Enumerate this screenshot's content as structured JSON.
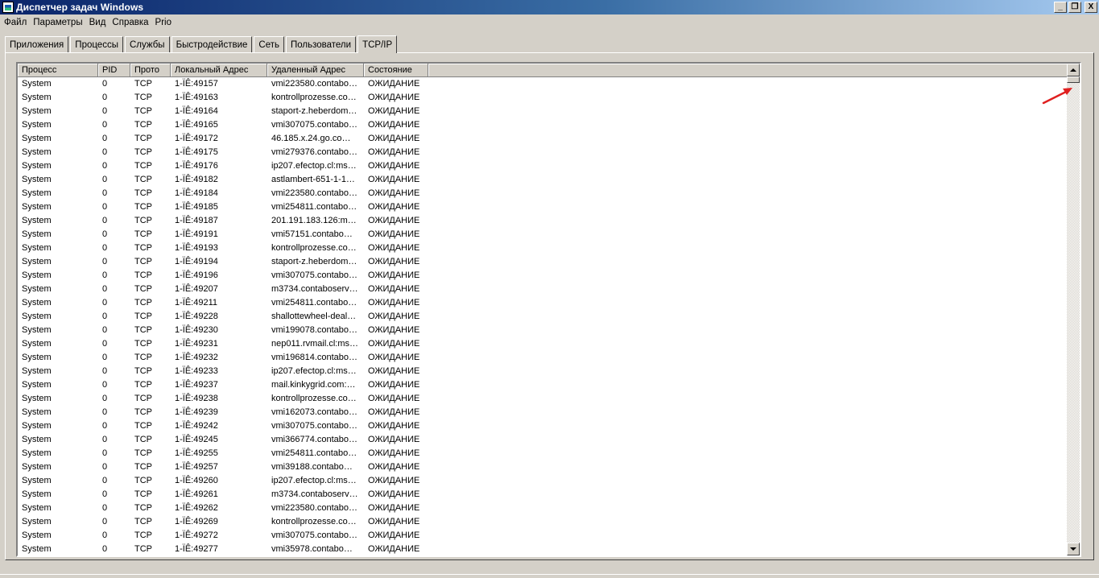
{
  "window": {
    "title": "Диспетчер задач Windows",
    "controls": {
      "minimize": "_",
      "restore": "❐",
      "close": "X"
    }
  },
  "menu": [
    "Файл",
    "Параметры",
    "Вид",
    "Справка",
    "Prio"
  ],
  "tabs": [
    "Приложения",
    "Процессы",
    "Службы",
    "Быстродействие",
    "Сеть",
    "Пользователи",
    "TCP/IP"
  ],
  "active_tab": "TCP/IP",
  "table": {
    "columns": [
      "Процесс",
      "PID",
      "Прото",
      "Локальный Адрес",
      "Удаленный Адрес",
      "Состояние"
    ],
    "rows": [
      [
        "System",
        "0",
        "TCP",
        "1-ÏÊ:49157",
        "vmi223580.contabo…",
        "ОЖИДАНИЕ"
      ],
      [
        "System",
        "0",
        "TCP",
        "1-ÏÊ:49163",
        "kontrollprozesse.co…",
        "ОЖИДАНИЕ"
      ],
      [
        "System",
        "0",
        "TCP",
        "1-ÏÊ:49164",
        "staport-z.heberdom…",
        "ОЖИДАНИЕ"
      ],
      [
        "System",
        "0",
        "TCP",
        "1-ÏÊ:49165",
        "vmi307075.contabo…",
        "ОЖИДАНИЕ"
      ],
      [
        "System",
        "0",
        "TCP",
        "1-ÏÊ:49172",
        "46.185.x.24.go.co…",
        "ОЖИДАНИЕ"
      ],
      [
        "System",
        "0",
        "TCP",
        "1-ÏÊ:49175",
        "vmi279376.contabo…",
        "ОЖИДАНИЕ"
      ],
      [
        "System",
        "0",
        "TCP",
        "1-ÏÊ:49176",
        "ip207.efectop.cl:ms…",
        "ОЖИДАНИЕ"
      ],
      [
        "System",
        "0",
        "TCP",
        "1-ÏÊ:49182",
        "astlambert-651-1-1…",
        "ОЖИДАНИЕ"
      ],
      [
        "System",
        "0",
        "TCP",
        "1-ÏÊ:49184",
        "vmi223580.contabo…",
        "ОЖИДАНИЕ"
      ],
      [
        "System",
        "0",
        "TCP",
        "1-ÏÊ:49185",
        "vmi254811.contabo…",
        "ОЖИДАНИЕ"
      ],
      [
        "System",
        "0",
        "TCP",
        "1-ÏÊ:49187",
        "201.191.183.126:m…",
        "ОЖИДАНИЕ"
      ],
      [
        "System",
        "0",
        "TCP",
        "1-ÏÊ:49191",
        "vmi57151.contabo…",
        "ОЖИДАНИЕ"
      ],
      [
        "System",
        "0",
        "TCP",
        "1-ÏÊ:49193",
        "kontrollprozesse.co…",
        "ОЖИДАНИЕ"
      ],
      [
        "System",
        "0",
        "TCP",
        "1-ÏÊ:49194",
        "staport-z.heberdom…",
        "ОЖИДАНИЕ"
      ],
      [
        "System",
        "0",
        "TCP",
        "1-ÏÊ:49196",
        "vmi307075.contabo…",
        "ОЖИДАНИЕ"
      ],
      [
        "System",
        "0",
        "TCP",
        "1-ÏÊ:49207",
        "m3734.contaboserv…",
        "ОЖИДАНИЕ"
      ],
      [
        "System",
        "0",
        "TCP",
        "1-ÏÊ:49211",
        "vmi254811.contabo…",
        "ОЖИДАНИЕ"
      ],
      [
        "System",
        "0",
        "TCP",
        "1-ÏÊ:49228",
        "shallottewheel-deal…",
        "ОЖИДАНИЕ"
      ],
      [
        "System",
        "0",
        "TCP",
        "1-ÏÊ:49230",
        "vmi199078.contabo…",
        "ОЖИДАНИЕ"
      ],
      [
        "System",
        "0",
        "TCP",
        "1-ÏÊ:49231",
        "nep011.rvmail.cl:ms…",
        "ОЖИДАНИЕ"
      ],
      [
        "System",
        "0",
        "TCP",
        "1-ÏÊ:49232",
        "vmi196814.contabo…",
        "ОЖИДАНИЕ"
      ],
      [
        "System",
        "0",
        "TCP",
        "1-ÏÊ:49233",
        "ip207.efectop.cl:ms…",
        "ОЖИДАНИЕ"
      ],
      [
        "System",
        "0",
        "TCP",
        "1-ÏÊ:49237",
        "mail.kinkygrid.com:…",
        "ОЖИДАНИЕ"
      ],
      [
        "System",
        "0",
        "TCP",
        "1-ÏÊ:49238",
        "kontrollprozesse.co…",
        "ОЖИДАНИЕ"
      ],
      [
        "System",
        "0",
        "TCP",
        "1-ÏÊ:49239",
        "vmi162073.contabo…",
        "ОЖИДАНИЕ"
      ],
      [
        "System",
        "0",
        "TCP",
        "1-ÏÊ:49242",
        "vmi307075.contabo…",
        "ОЖИДАНИЕ"
      ],
      [
        "System",
        "0",
        "TCP",
        "1-ÏÊ:49245",
        "vmi366774.contabo…",
        "ОЖИДАНИЕ"
      ],
      [
        "System",
        "0",
        "TCP",
        "1-ÏÊ:49255",
        "vmi254811.contabo…",
        "ОЖИДАНИЕ"
      ],
      [
        "System",
        "0",
        "TCP",
        "1-ÏÊ:49257",
        "vmi39188.contabo…",
        "ОЖИДАНИЕ"
      ],
      [
        "System",
        "0",
        "TCP",
        "1-ÏÊ:49260",
        "ip207.efectop.cl:ms…",
        "ОЖИДАНИЕ"
      ],
      [
        "System",
        "0",
        "TCP",
        "1-ÏÊ:49261",
        "m3734.contaboserv…",
        "ОЖИДАНИЕ"
      ],
      [
        "System",
        "0",
        "TCP",
        "1-ÏÊ:49262",
        "vmi223580.contabo…",
        "ОЖИДАНИЕ"
      ],
      [
        "System",
        "0",
        "TCP",
        "1-ÏÊ:49269",
        "kontrollprozesse.co…",
        "ОЖИДАНИЕ"
      ],
      [
        "System",
        "0",
        "TCP",
        "1-ÏÊ:49272",
        "vmi307075.contabo…",
        "ОЖИДАНИЕ"
      ],
      [
        "System",
        "0",
        "TCP",
        "1-ÏÊ:49277",
        "vmi35978.contabo…",
        "ОЖИДАНИЕ"
      ]
    ]
  },
  "annotation": {
    "arrow_color": "#e02020"
  },
  "icons": {
    "app": "task-manager-icon",
    "scroll_up": "scroll-up-arrow-icon",
    "scroll_down": "scroll-down-arrow-icon",
    "annotation": "red-arrow-icon"
  }
}
